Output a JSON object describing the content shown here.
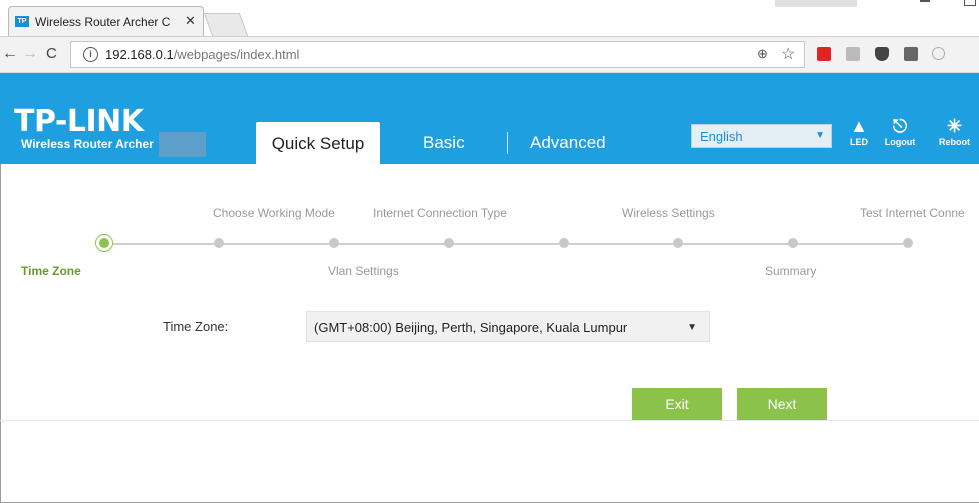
{
  "browser": {
    "tab_title": "Wireless Router Archer C",
    "tab_favicon": "TP",
    "tab_close": "✕",
    "url_host": "192.168.0.1",
    "url_path": "/webpages/index.html",
    "nav_back": "←",
    "nav_forward": "→",
    "nav_reload": "C",
    "info_icon_glyph": "i",
    "zoom_icon_glyph": "⊕",
    "star_icon_glyph": "☆"
  },
  "header": {
    "logo": "TP-LINK",
    "model": "Wireless Router Archer",
    "tabs": [
      {
        "label": "Quick Setup",
        "active": true
      },
      {
        "label": "Basic",
        "active": false
      },
      {
        "label": "Advanced",
        "active": false
      }
    ],
    "language": "English",
    "icons": [
      {
        "name": "led-icon",
        "label": "LED",
        "glyph": "🔔"
      },
      {
        "name": "logout-icon",
        "label": "Logout",
        "glyph": "⍈"
      },
      {
        "name": "reboot-icon",
        "label": "Reboot",
        "glyph": "✳"
      }
    ],
    "accent_color": "#1e9fe0"
  },
  "steps": {
    "top": [
      "Choose Working Mode",
      "Internet Connection Type",
      "Wireless Settings",
      "Test Internet Conne"
    ],
    "bottom": [
      "Vlan Settings",
      "Summary"
    ],
    "current": "Time Zone",
    "total_dots": 8,
    "current_index": 0,
    "active_color": "#8bc34a"
  },
  "form": {
    "time_zone_label": "Time Zone:",
    "time_zone_value": "(GMT+08:00) Beijing, Perth, Singapore, Kuala Lumpur"
  },
  "buttons": {
    "exit": "Exit",
    "next": "Next"
  }
}
